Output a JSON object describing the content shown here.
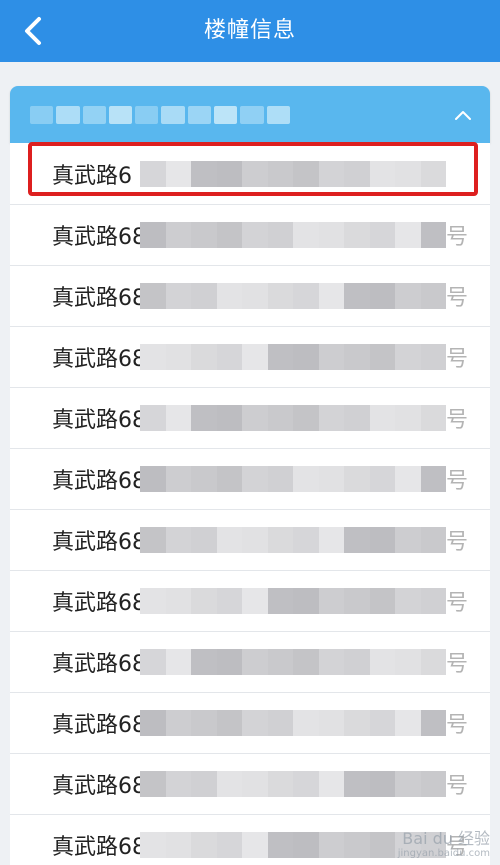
{
  "header": {
    "title": "楼幢信息",
    "back_icon": "chevron-left-icon",
    "bg": "#2e8fe6"
  },
  "section": {
    "bg": "#59b7ee",
    "expand_icon": "chevron-up-icon"
  },
  "list": {
    "items": [
      {
        "label": "真武路6",
        "highlighted": true,
        "suffix": ""
      },
      {
        "label": "真武路68",
        "suffix": "号"
      },
      {
        "label": "真武路68",
        "suffix": "号"
      },
      {
        "label": "真武路68",
        "suffix": "号"
      },
      {
        "label": "真武路68",
        "suffix": "号"
      },
      {
        "label": "真武路68",
        "suffix": "号"
      },
      {
        "label": "真武路68",
        "suffix": "号"
      },
      {
        "label": "真武路68",
        "suffix": "号"
      },
      {
        "label": "真武路68",
        "suffix": "号"
      },
      {
        "label": "真武路68",
        "suffix": "号"
      },
      {
        "label": "真武路68",
        "suffix": "号"
      },
      {
        "label": "真武路68",
        "suffix": "号"
      }
    ]
  },
  "highlight_color": "#dd1f1f",
  "watermark": {
    "brand": "Bai du 经验",
    "url": "jingyan.baidu.com"
  }
}
